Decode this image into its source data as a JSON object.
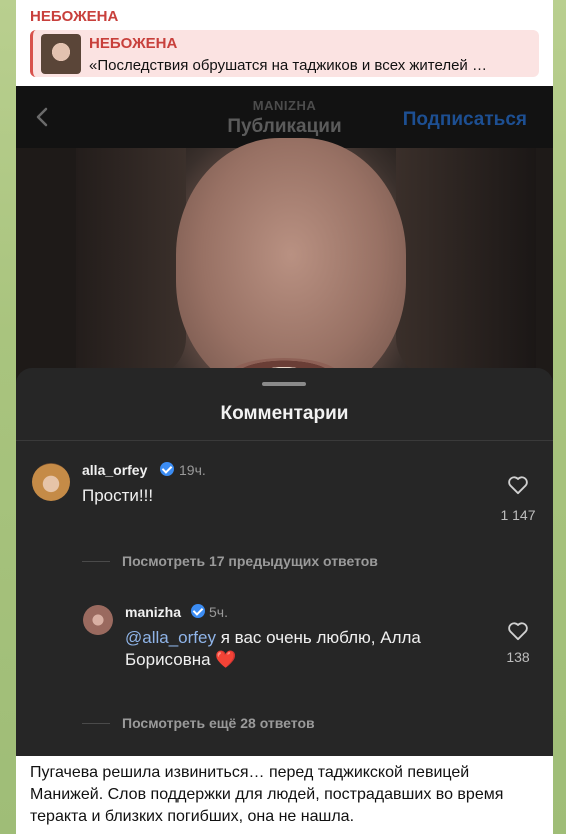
{
  "message": {
    "channel_name": "НЕБОЖЕНА",
    "reply": {
      "title": "НЕБОЖЕНА",
      "text": "«Последствия обрушатся на таджиков и всех жителей …"
    },
    "caption": "Пугачева решила извиниться… перед таджикской певицей Манижей. Слов поддержки для людей, пострадавших во время теракта и близких погибших, она не нашла."
  },
  "instagram": {
    "header": {
      "username": "MANIZHA",
      "title": "Публикации",
      "subscribe_label": "Подписаться"
    },
    "comments_sheet": {
      "title": "Комментарии",
      "comments": [
        {
          "username": "alla_orfey",
          "time": "19ч.",
          "text": "Прости!!!",
          "likes": "1 147"
        }
      ],
      "view_previous": "Посмотреть 17 предыдущих ответов",
      "replies": [
        {
          "username": "manizha",
          "time": "5ч.",
          "mention": "@alla_orfey",
          "text_line1": " я вас очень люблю, Алла",
          "text_line2": "Борисовна ",
          "emoji": "❤️",
          "likes": "138"
        }
      ],
      "view_more": "Посмотреть ещё 28 ответов"
    }
  },
  "colors": {
    "channel_accent": "#c8403c",
    "verified_badge": "#3b8cf3",
    "subscribe_text": "#1d4f92"
  }
}
